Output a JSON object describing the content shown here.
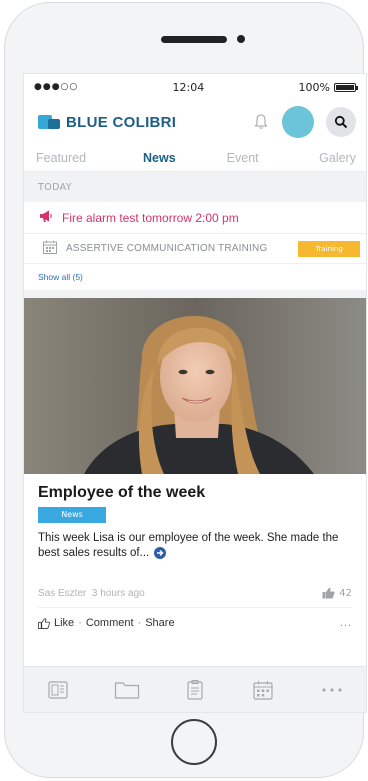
{
  "status_bar": {
    "signal": "●●●○○",
    "time": "12:04",
    "battery": "100%"
  },
  "header": {
    "brand": "BLUE COLIBRI",
    "icons": [
      "bell-icon",
      "avatar",
      "search-icon"
    ]
  },
  "tabs": [
    {
      "label": "Featured",
      "active": false
    },
    {
      "label": "News",
      "active": true
    },
    {
      "label": "Event",
      "active": false
    },
    {
      "label": "Galery",
      "active": false
    }
  ],
  "feed": {
    "section_label": "TODAY",
    "alert": {
      "icon": "megaphone-icon",
      "text": "Fire alarm test tomorrow 2:00 pm"
    },
    "event": {
      "icon": "calendar-icon",
      "text": "ASSERTIVE COMMUNICATION TRAINING",
      "tag": "Training"
    },
    "show_all": "Show all (5)"
  },
  "post": {
    "title": "Employee of the week",
    "badge": "News",
    "body": "This week Lisa is our employee of the week. She made the best sales results of...",
    "author": "Sas Eszter",
    "time": "3 hours ago",
    "likes": "42",
    "actions": {
      "like": "Like",
      "comment": "Comment",
      "share": "Share",
      "more": "..."
    }
  },
  "bottom_nav": [
    "news-icon",
    "folder-icon",
    "clipboard-icon",
    "calendar-icon",
    "more-icon"
  ],
  "colors": {
    "brand": "#1d5f86",
    "accent": "#35a9d6",
    "alert": "#d6336c",
    "training": "#f5b82e",
    "news_badge": "#3aa8e0"
  }
}
